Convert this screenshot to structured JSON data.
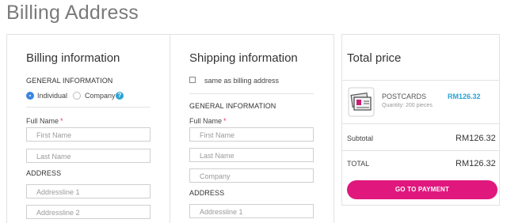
{
  "page": {
    "title": "Billing Address"
  },
  "billing": {
    "heading": "Billing information",
    "general_label": "GENERAL INFORMATION",
    "option_individual": "Individual",
    "option_company": "Company",
    "help_glyph": "?",
    "full_name_label": "Full Name",
    "required_mark": "*",
    "first_name_placeholder": "First Name",
    "last_name_placeholder": "Last Name",
    "address_label": "ADDRESS",
    "address1_placeholder": "Addressline 1",
    "address2_placeholder": "Addressline 2"
  },
  "shipping": {
    "heading": "Shipping information",
    "same_as_billing": "same as billing address",
    "general_label": "GENERAL INFORMATION",
    "full_name_label": "Full Name",
    "required_mark": "*",
    "first_name_placeholder": "First Name",
    "last_name_placeholder": "Last Name",
    "company_placeholder": "Company",
    "address_label": "ADDRESS",
    "address1_placeholder": "Addressline 1"
  },
  "total": {
    "heading": "Total price",
    "product_name": "POSTCARDS",
    "product_qty": "Quantity: 200 pieces",
    "product_price": "RM126.32",
    "subtotal_label": "Subtotal",
    "subtotal_value": "RM126.32",
    "total_label": "TOTAL",
    "total_value": "RM126.32",
    "pay_button": "GO TO PAYMENT"
  },
  "colors": {
    "accent": "#e0187e",
    "link": "#2aa3d6",
    "radio_selected": "#3b86e0"
  },
  "icons": {
    "product": "postcards-icon",
    "help": "help-circle-icon"
  }
}
